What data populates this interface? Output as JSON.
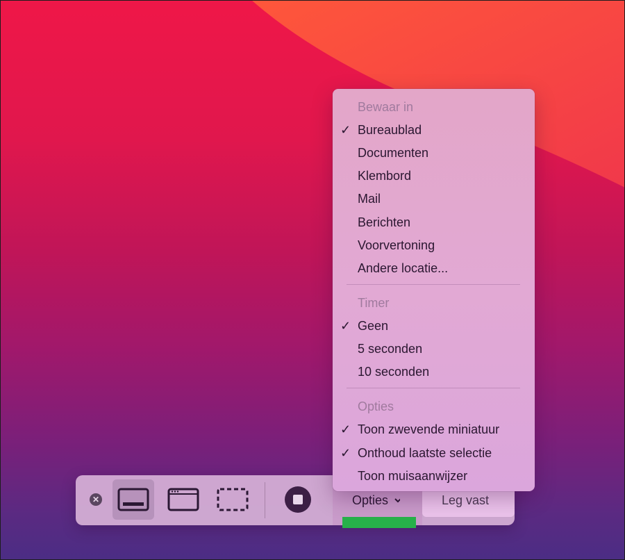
{
  "menu": {
    "section_save_header": "Bewaar in",
    "save_items": [
      {
        "label": "Bureaublad",
        "checked": true
      },
      {
        "label": "Documenten",
        "checked": false
      },
      {
        "label": "Klembord",
        "checked": false
      },
      {
        "label": "Mail",
        "checked": false
      },
      {
        "label": "Berichten",
        "checked": false
      },
      {
        "label": "Voorvertoning",
        "checked": false
      },
      {
        "label": "Andere locatie...",
        "checked": false
      }
    ],
    "section_timer_header": "Timer",
    "timer_items": [
      {
        "label": "Geen",
        "checked": true
      },
      {
        "label": "5 seconden",
        "checked": false
      },
      {
        "label": "10 seconden",
        "checked": false
      }
    ],
    "section_options_header": "Opties",
    "option_items": [
      {
        "label": "Toon zwevende miniatuur",
        "checked": true
      },
      {
        "label": "Onthoud laatste selectie",
        "checked": true
      },
      {
        "label": "Toon muisaanwijzer",
        "checked": false
      }
    ],
    "check_glyph": "✓"
  },
  "toolbar": {
    "close_glyph": "✕",
    "options_label": "Opties",
    "capture_label": "Leg vast"
  },
  "icons": {
    "close": "close-icon",
    "capture_screen": "capture-entire-screen-icon",
    "capture_window": "capture-window-icon",
    "capture_selection": "capture-selection-icon",
    "record": "record-icon",
    "chevron": "chevron-down-icon"
  },
  "colors": {
    "highlight_bar": "#27b14a"
  }
}
